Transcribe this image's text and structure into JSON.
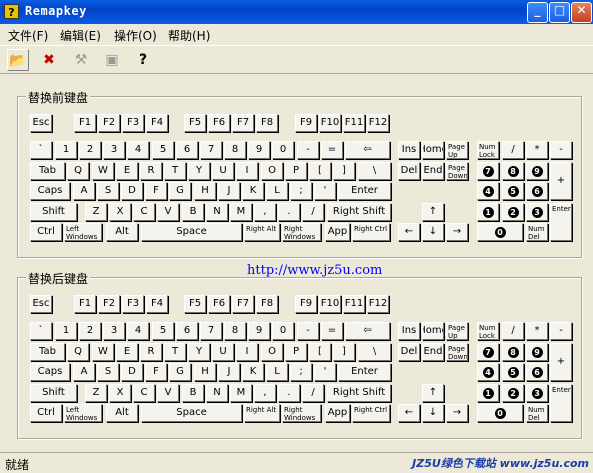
{
  "window": {
    "title": "Remapkey",
    "icon": "question-icon",
    "minimize": "_",
    "maximize": "□",
    "close": "✕"
  },
  "menu": [
    "文件(F)",
    "编辑(E)",
    "操作(O)",
    "帮助(H)"
  ],
  "toolbar": [
    {
      "name": "open-icon",
      "glyph": "📂"
    },
    {
      "name": "delete-icon",
      "glyph": "❌"
    },
    {
      "name": "remap-icon",
      "glyph": "🔨"
    },
    {
      "name": "save-icon",
      "glyph": "▣"
    },
    {
      "name": "help-icon",
      "glyph": "?"
    }
  ],
  "before_group": {
    "label": "替换前键盘"
  },
  "after_group": {
    "label": "替换后键盘"
  },
  "url": "http://www.jz5u.com",
  "status": {
    "text": "就绪",
    "watermark": "JZ5U绿色下载站 www.jz5u.com"
  },
  "keys": {
    "esc": "Esc",
    "f1": "F1",
    "f2": "F2",
    "f3": "F3",
    "f4": "F4",
    "f5": "F5",
    "f6": "F6",
    "f7": "F7",
    "f8": "F8",
    "f9": "F9",
    "f10": "F10",
    "f11": "F11",
    "f12": "F12",
    "grave": "`",
    "k1": "1",
    "k2": "2",
    "k3": "3",
    "k4": "4",
    "k5": "5",
    "k6": "6",
    "k7": "7",
    "k8": "8",
    "k9": "9",
    "k0": "0",
    "minus": "-",
    "equal": "=",
    "backspace": "⇦",
    "tab": "Tab",
    "q": "Q",
    "w": "W",
    "e": "E",
    "r": "R",
    "t": "T",
    "y": "Y",
    "u": "U",
    "i": "I",
    "o": "O",
    "p": "P",
    "lbracket": "[",
    "rbracket": "]",
    "backslash": "\\",
    "caps": "Caps",
    "a": "A",
    "s": "S",
    "d": "D",
    "f": "F",
    "g": "G",
    "h": "H",
    "j": "J",
    "k": "K",
    "l": "L",
    "semicolon": ";",
    "quote": "'",
    "enter": "Enter",
    "shift": "Shift",
    "z": "Z",
    "x": "X",
    "c": "C",
    "v": "V",
    "b": "B",
    "n": "N",
    "m": "M",
    "comma": ",",
    "period": ".",
    "slash": "/",
    "rshift": "Right Shift",
    "ctrl": "Ctrl",
    "lwin": "Left Windows",
    "alt": "Alt",
    "space": "Space",
    "ralt": "Right Alt",
    "rwin": "Right Windows",
    "app": "App",
    "rctrl": "Right Ctrl",
    "ins": "Ins",
    "home": "Home",
    "pgup": "Page Up",
    "del": "Del",
    "end": "End",
    "pgdn": "Page Down",
    "up": "↑",
    "left": "←",
    "down": "↓",
    "right": "→",
    "numlock": "Num Lock",
    "ndiv": "/",
    "nmul": "*",
    "nsub": "-",
    "n7": "7",
    "n8": "8",
    "n9": "9",
    "nadd": "+",
    "n4": "4",
    "n5": "5",
    "n6": "6",
    "n1": "1",
    "n2": "2",
    "n3": "3",
    "nenter": "Enter",
    "n0": "0",
    "ndel": "Num Del"
  }
}
